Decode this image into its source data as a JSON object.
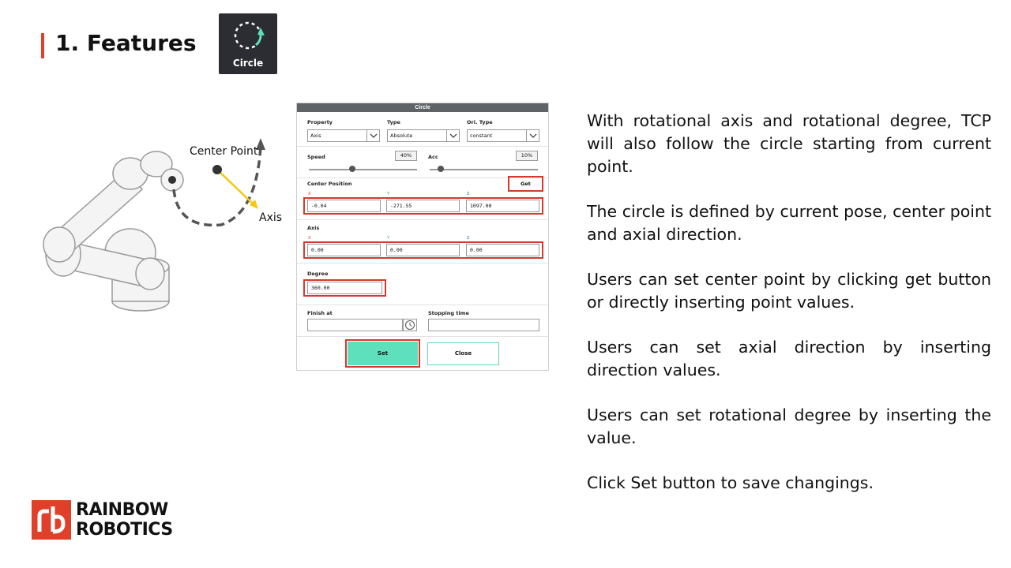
{
  "slide": {
    "title": "1. Features",
    "tile_label": "Circle"
  },
  "figure": {
    "center_point_label": "Center Point",
    "axis_label": "Axis"
  },
  "dialog": {
    "title": "Circle",
    "property": {
      "label": "Property",
      "value": "Axis"
    },
    "type": {
      "label": "Type",
      "value": "Absolute"
    },
    "ori_type": {
      "label": "Ori. Type",
      "value": "constant"
    },
    "speed": {
      "label": "Speed",
      "value": "40%",
      "level": 0.4
    },
    "acc": {
      "label": "Acc",
      "value": "10%",
      "level": 0.1
    },
    "center_position": {
      "label": "Center Position",
      "get_label": "Get",
      "x_label": "X",
      "y_label": "Y",
      "z_label": "Z",
      "x": "-0.04",
      "y": "-271.55",
      "z": "1097.00"
    },
    "axis": {
      "label": "Axis",
      "x_label": "X",
      "y_label": "Y",
      "z_label": "Z",
      "x": "0.00",
      "y": "0.00",
      "z": "0.00"
    },
    "degree": {
      "label": "Degree",
      "value": "360.00"
    },
    "finish_at": {
      "label": "Finish at",
      "value": ""
    },
    "stopping_time": {
      "label": "Stopping time",
      "value": ""
    },
    "set_label": "Set",
    "close_label": "Close"
  },
  "description": [
    "With rotational axis and rotational degree, TCP will also follow the circle starting from current point.",
    "The circle is defined by current pose, center point and axial direction.",
    "Users can set center point by clicking get button or directly inserting point values.",
    "Users can set axial direction by inserting direction values.",
    "Users can set rotational degree by inserting the value.",
    "Click Set button to save changings."
  ],
  "logo": {
    "line1": "RAINBOW",
    "line2": "ROBOTICS"
  },
  "colors": {
    "accent_red": "#e0402a",
    "highlight_red": "#d6392c",
    "set_button": "#5fe0bd",
    "tile_bg": "#2b2d33",
    "arrow_yellow": "#f2c811"
  }
}
